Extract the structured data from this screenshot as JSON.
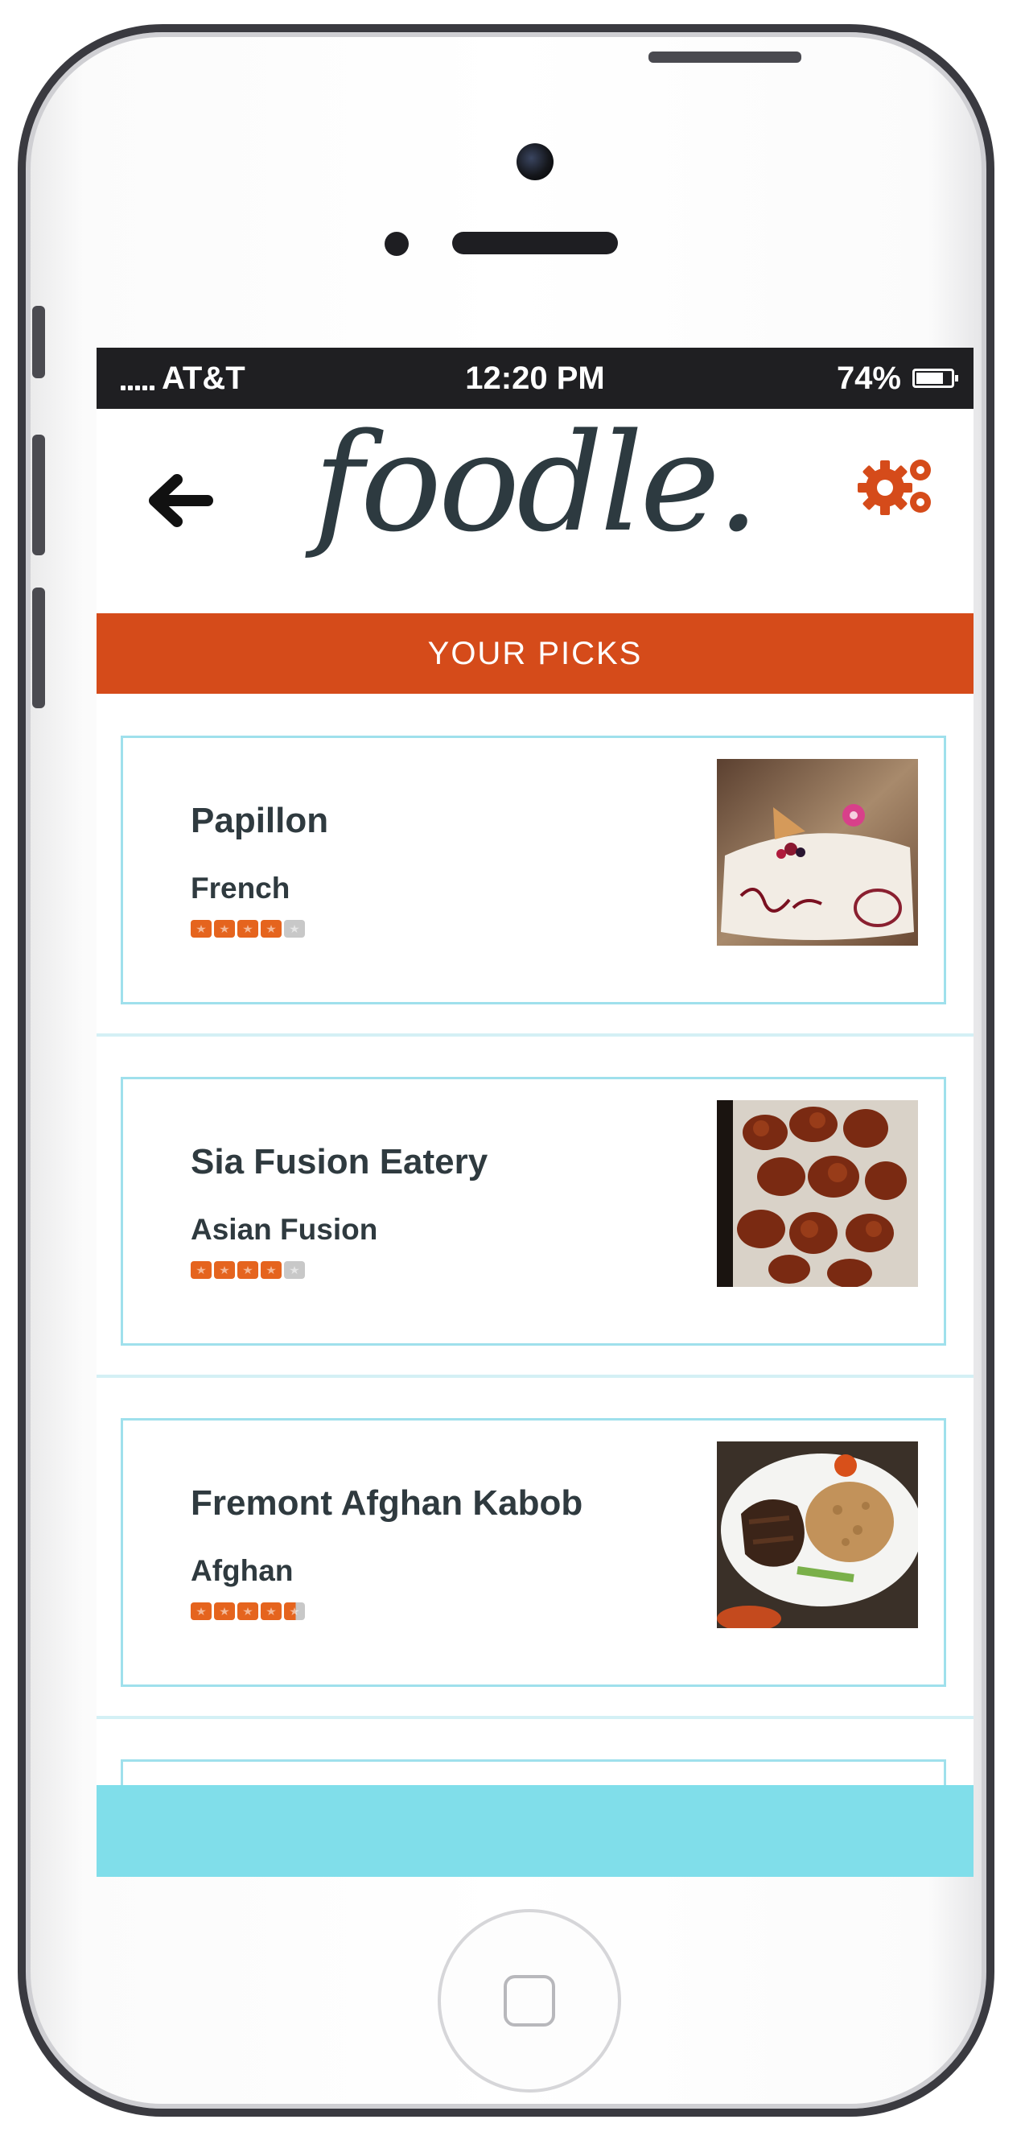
{
  "status_bar": {
    "carrier": "AT&T",
    "time": "12:20 PM",
    "battery": "74%"
  },
  "header": {
    "logo_text": "foodle."
  },
  "banner": {
    "title": "YOUR PICKS"
  },
  "colors": {
    "accent": "#d54b1a",
    "card_border": "#9fe0ec",
    "footer": "#80deea",
    "star_on": "#e5641e",
    "star_off": "#c8c8c8",
    "text": "#2f3a3f"
  },
  "picks": [
    {
      "name": "Papillon",
      "cuisine": "French",
      "rating": 4,
      "photo": "dessert-plate-photo"
    },
    {
      "name": "Sia Fusion Eatery",
      "cuisine": "Asian Fusion",
      "rating": 4,
      "photo": "fried-chicken-photo"
    },
    {
      "name": "Fremont Afghan Kabob",
      "cuisine": "Afghan",
      "rating": 4.5,
      "photo": "kabob-plate-photo"
    }
  ]
}
